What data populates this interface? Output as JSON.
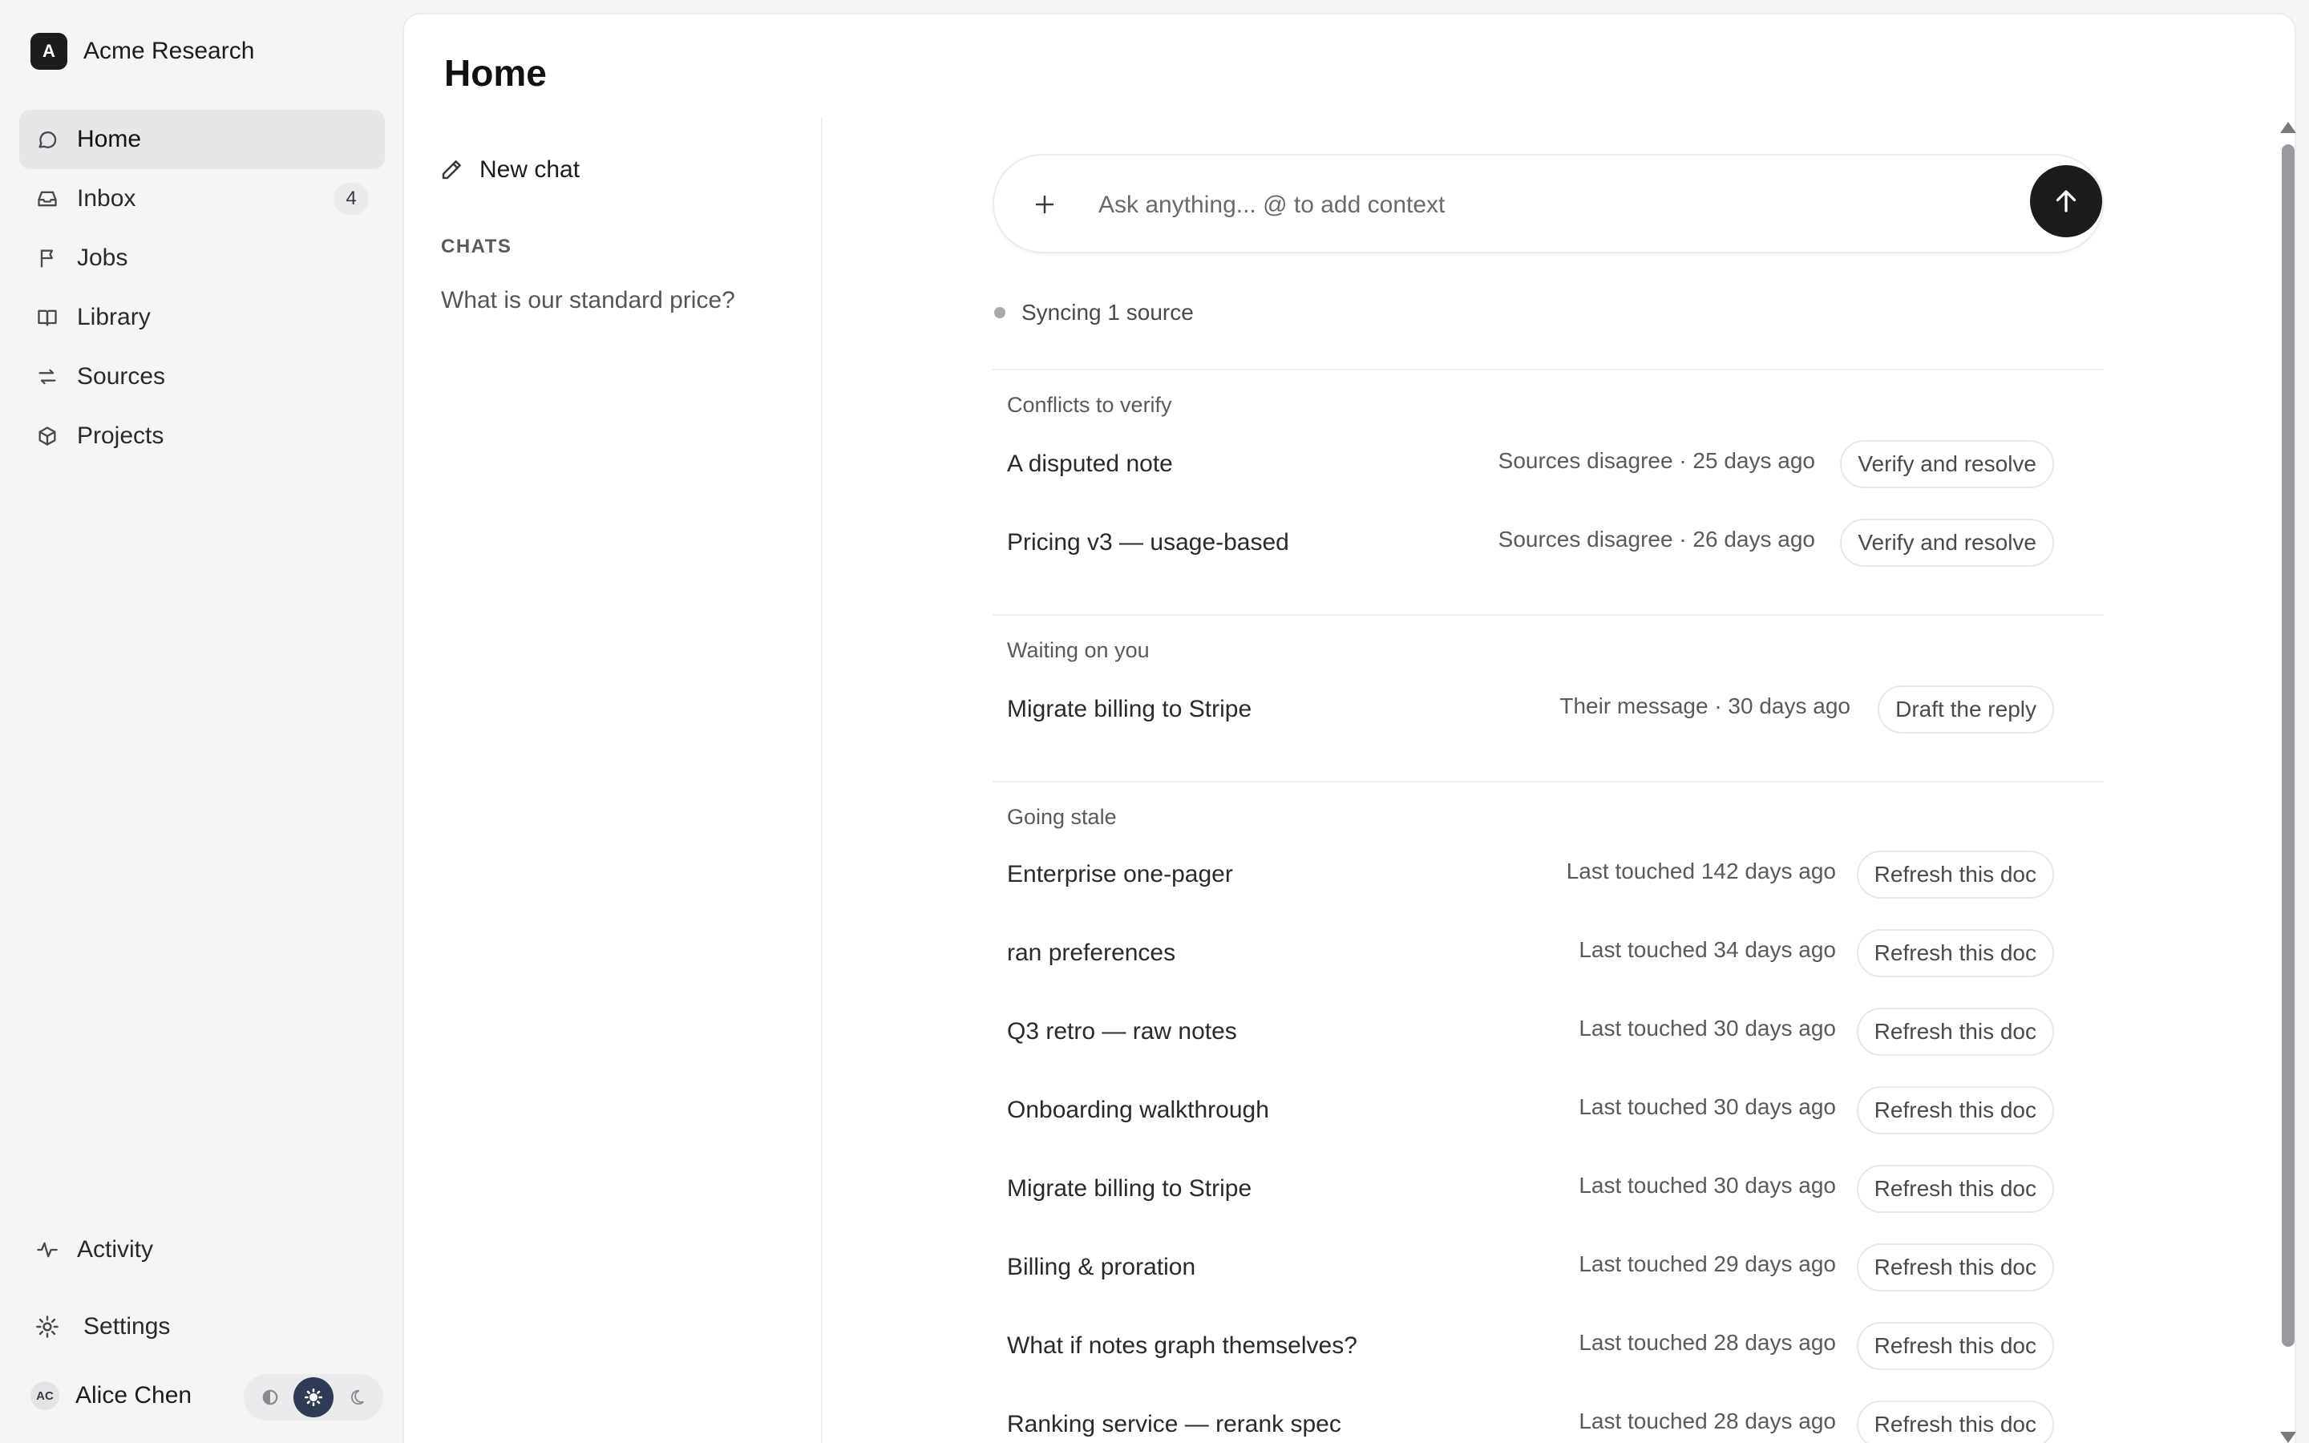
{
  "workspace": {
    "initial": "A",
    "name": "Acme Research"
  },
  "nav": {
    "items": [
      {
        "label": "Home",
        "icon": "chat-bubble-icon",
        "active": true
      },
      {
        "label": "Inbox",
        "icon": "inbox-icon",
        "badge": "4"
      },
      {
        "label": "Jobs",
        "icon": "flag-icon"
      },
      {
        "label": "Library",
        "icon": "book-icon"
      },
      {
        "label": "Sources",
        "icon": "arrows-swap-icon"
      },
      {
        "label": "Projects",
        "icon": "cube-icon"
      }
    ],
    "bottom": [
      {
        "label": "Activity",
        "icon": "pulse-icon"
      },
      {
        "label": "Settings",
        "icon": "gear-icon"
      }
    ]
  },
  "user": {
    "initials": "AC",
    "name": "Alice Chen"
  },
  "theme": {
    "options": [
      "contrast",
      "light",
      "dark"
    ],
    "selected": "light"
  },
  "page": {
    "title": "Home"
  },
  "chats": {
    "new_chat_label": "New chat",
    "heading": "CHATS",
    "items": [
      "What is our standard price?"
    ]
  },
  "ask": {
    "placeholder": "Ask anything... @ to add context"
  },
  "sync": {
    "text": "Syncing 1 source"
  },
  "sections": {
    "conflicts": {
      "title": "Conflicts to verify",
      "rows": [
        {
          "title": "A disputed note",
          "meta": "Sources disagree · 25 days ago",
          "action": "Verify and resolve"
        },
        {
          "title": "Pricing v3 — usage-based",
          "meta": "Sources disagree · 26 days ago",
          "action": "Verify and resolve"
        }
      ]
    },
    "waiting": {
      "title": "Waiting on you",
      "rows": [
        {
          "title": "Migrate billing to Stripe",
          "meta": "Their message · 30 days ago",
          "action": "Draft the reply"
        }
      ]
    },
    "stale": {
      "title": "Going stale",
      "rows": [
        {
          "title": "Enterprise one-pager",
          "meta": "Last touched 142 days ago",
          "action": "Refresh this doc"
        },
        {
          "title": "ran preferences",
          "meta": "Last touched 34 days ago",
          "action": "Refresh this doc"
        },
        {
          "title": "Q3 retro — raw notes",
          "meta": "Last touched 30 days ago",
          "action": "Refresh this doc"
        },
        {
          "title": "Onboarding walkthrough",
          "meta": "Last touched 30 days ago",
          "action": "Refresh this doc"
        },
        {
          "title": "Migrate billing to Stripe",
          "meta": "Last touched 30 days ago",
          "action": "Refresh this doc"
        },
        {
          "title": "Billing & proration",
          "meta": "Last touched 29 days ago",
          "action": "Refresh this doc"
        },
        {
          "title": "What if notes graph themselves?",
          "meta": "Last touched 28 days ago",
          "action": "Refresh this doc"
        },
        {
          "title": "Ranking service — rerank spec",
          "meta": "Last touched 28 days ago",
          "action": "Refresh this doc"
        }
      ]
    }
  }
}
